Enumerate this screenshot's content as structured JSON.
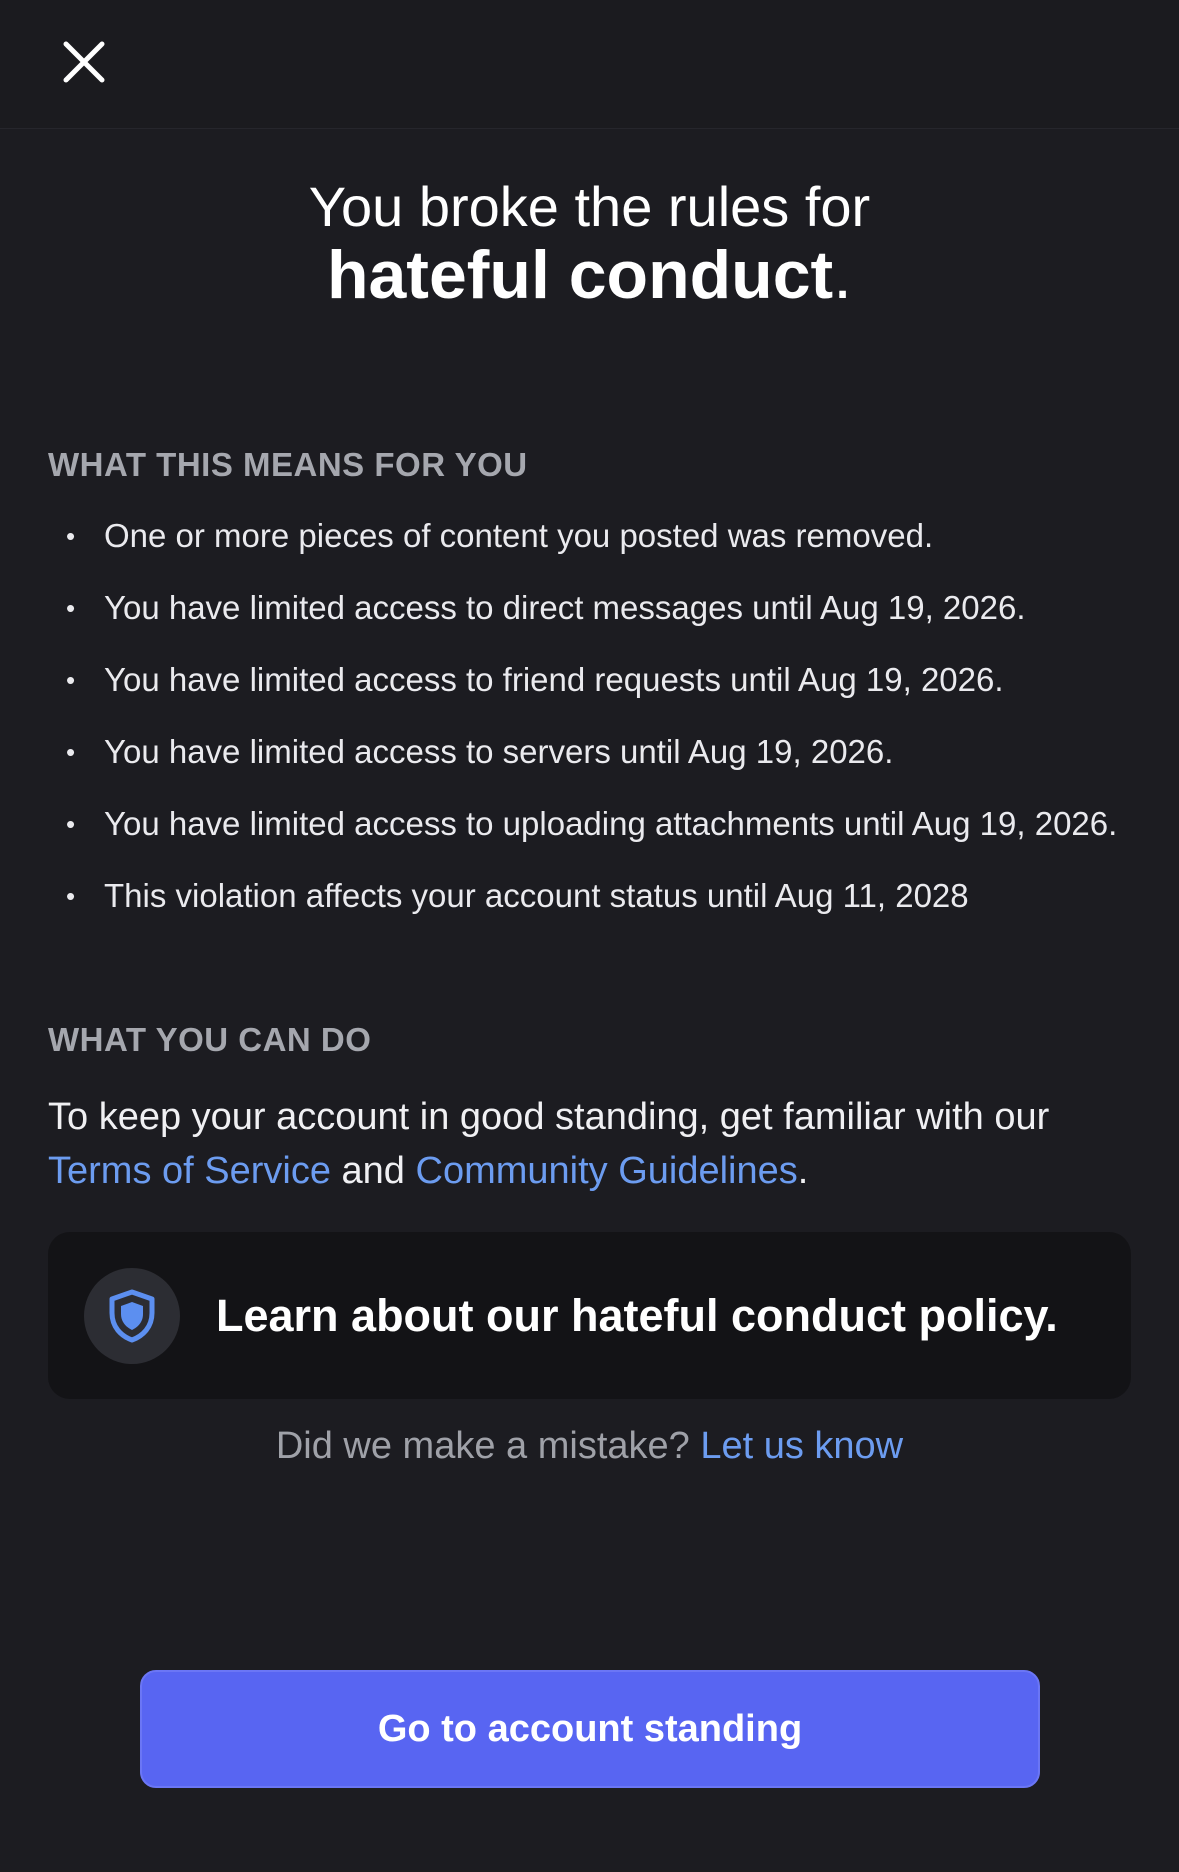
{
  "header": {
    "close_icon": "close-icon"
  },
  "title": {
    "line1": "You broke the rules for",
    "emphasis": "hateful conduct",
    "period": "."
  },
  "consequences": {
    "heading": "WHAT THIS MEANS FOR YOU",
    "items": [
      "One or more pieces of content you posted was removed.",
      "You have limited access to direct messages until Aug 19, 2026.",
      "You have limited access to friend requests until Aug 19, 2026.",
      "You have limited access to servers until Aug 19, 2026.",
      "You have limited access to uploading attachments until Aug 19, 2026.",
      "This violation affects your account status until Aug 11, 2028"
    ]
  },
  "actions": {
    "heading": "WHAT YOU CAN DO",
    "text_before": "To keep your account in good standing, get familiar with our",
    "tos_link": "Terms of Service",
    "and_text": "and",
    "guidelines_link": "Community Guidelines",
    "end_period": "."
  },
  "policy_card": {
    "icon": "shield-icon",
    "label": "Learn about our hateful conduct policy."
  },
  "mistake": {
    "question": "Did we make a mistake?",
    "link": "Let us know"
  },
  "footer": {
    "button_label": "Go to account standing"
  },
  "colors": {
    "background": "#1c1c21",
    "link": "#6c9cf0",
    "primary_button": "#5865f2",
    "card": "#131316",
    "shield": "#5c8ff0"
  }
}
